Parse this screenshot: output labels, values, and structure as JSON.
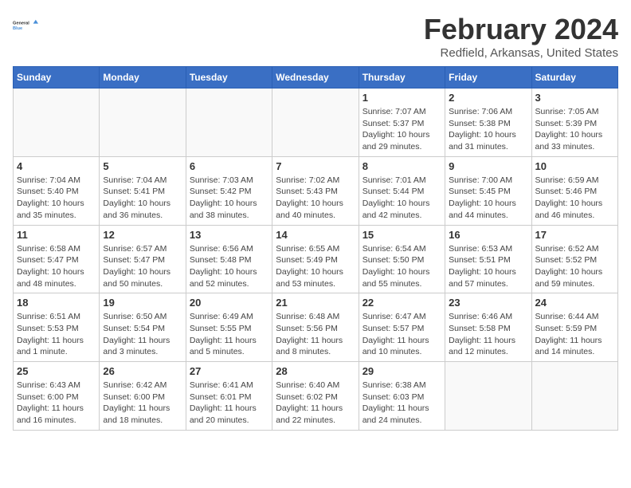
{
  "header": {
    "logo_line1": "General",
    "logo_line2": "Blue",
    "month_year": "February 2024",
    "location": "Redfield, Arkansas, United States"
  },
  "days_of_week": [
    "Sunday",
    "Monday",
    "Tuesday",
    "Wednesday",
    "Thursday",
    "Friday",
    "Saturday"
  ],
  "weeks": [
    [
      {
        "day": "",
        "info": ""
      },
      {
        "day": "",
        "info": ""
      },
      {
        "day": "",
        "info": ""
      },
      {
        "day": "",
        "info": ""
      },
      {
        "day": "1",
        "info": "Sunrise: 7:07 AM\nSunset: 5:37 PM\nDaylight: 10 hours\nand 29 minutes."
      },
      {
        "day": "2",
        "info": "Sunrise: 7:06 AM\nSunset: 5:38 PM\nDaylight: 10 hours\nand 31 minutes."
      },
      {
        "day": "3",
        "info": "Sunrise: 7:05 AM\nSunset: 5:39 PM\nDaylight: 10 hours\nand 33 minutes."
      }
    ],
    [
      {
        "day": "4",
        "info": "Sunrise: 7:04 AM\nSunset: 5:40 PM\nDaylight: 10 hours\nand 35 minutes."
      },
      {
        "day": "5",
        "info": "Sunrise: 7:04 AM\nSunset: 5:41 PM\nDaylight: 10 hours\nand 36 minutes."
      },
      {
        "day": "6",
        "info": "Sunrise: 7:03 AM\nSunset: 5:42 PM\nDaylight: 10 hours\nand 38 minutes."
      },
      {
        "day": "7",
        "info": "Sunrise: 7:02 AM\nSunset: 5:43 PM\nDaylight: 10 hours\nand 40 minutes."
      },
      {
        "day": "8",
        "info": "Sunrise: 7:01 AM\nSunset: 5:44 PM\nDaylight: 10 hours\nand 42 minutes."
      },
      {
        "day": "9",
        "info": "Sunrise: 7:00 AM\nSunset: 5:45 PM\nDaylight: 10 hours\nand 44 minutes."
      },
      {
        "day": "10",
        "info": "Sunrise: 6:59 AM\nSunset: 5:46 PM\nDaylight: 10 hours\nand 46 minutes."
      }
    ],
    [
      {
        "day": "11",
        "info": "Sunrise: 6:58 AM\nSunset: 5:47 PM\nDaylight: 10 hours\nand 48 minutes."
      },
      {
        "day": "12",
        "info": "Sunrise: 6:57 AM\nSunset: 5:47 PM\nDaylight: 10 hours\nand 50 minutes."
      },
      {
        "day": "13",
        "info": "Sunrise: 6:56 AM\nSunset: 5:48 PM\nDaylight: 10 hours\nand 52 minutes."
      },
      {
        "day": "14",
        "info": "Sunrise: 6:55 AM\nSunset: 5:49 PM\nDaylight: 10 hours\nand 53 minutes."
      },
      {
        "day": "15",
        "info": "Sunrise: 6:54 AM\nSunset: 5:50 PM\nDaylight: 10 hours\nand 55 minutes."
      },
      {
        "day": "16",
        "info": "Sunrise: 6:53 AM\nSunset: 5:51 PM\nDaylight: 10 hours\nand 57 minutes."
      },
      {
        "day": "17",
        "info": "Sunrise: 6:52 AM\nSunset: 5:52 PM\nDaylight: 10 hours\nand 59 minutes."
      }
    ],
    [
      {
        "day": "18",
        "info": "Sunrise: 6:51 AM\nSunset: 5:53 PM\nDaylight: 11 hours\nand 1 minute."
      },
      {
        "day": "19",
        "info": "Sunrise: 6:50 AM\nSunset: 5:54 PM\nDaylight: 11 hours\nand 3 minutes."
      },
      {
        "day": "20",
        "info": "Sunrise: 6:49 AM\nSunset: 5:55 PM\nDaylight: 11 hours\nand 5 minutes."
      },
      {
        "day": "21",
        "info": "Sunrise: 6:48 AM\nSunset: 5:56 PM\nDaylight: 11 hours\nand 8 minutes."
      },
      {
        "day": "22",
        "info": "Sunrise: 6:47 AM\nSunset: 5:57 PM\nDaylight: 11 hours\nand 10 minutes."
      },
      {
        "day": "23",
        "info": "Sunrise: 6:46 AM\nSunset: 5:58 PM\nDaylight: 11 hours\nand 12 minutes."
      },
      {
        "day": "24",
        "info": "Sunrise: 6:44 AM\nSunset: 5:59 PM\nDaylight: 11 hours\nand 14 minutes."
      }
    ],
    [
      {
        "day": "25",
        "info": "Sunrise: 6:43 AM\nSunset: 6:00 PM\nDaylight: 11 hours\nand 16 minutes."
      },
      {
        "day": "26",
        "info": "Sunrise: 6:42 AM\nSunset: 6:00 PM\nDaylight: 11 hours\nand 18 minutes."
      },
      {
        "day": "27",
        "info": "Sunrise: 6:41 AM\nSunset: 6:01 PM\nDaylight: 11 hours\nand 20 minutes."
      },
      {
        "day": "28",
        "info": "Sunrise: 6:40 AM\nSunset: 6:02 PM\nDaylight: 11 hours\nand 22 minutes."
      },
      {
        "day": "29",
        "info": "Sunrise: 6:38 AM\nSunset: 6:03 PM\nDaylight: 11 hours\nand 24 minutes."
      },
      {
        "day": "",
        "info": ""
      },
      {
        "day": "",
        "info": ""
      }
    ]
  ]
}
